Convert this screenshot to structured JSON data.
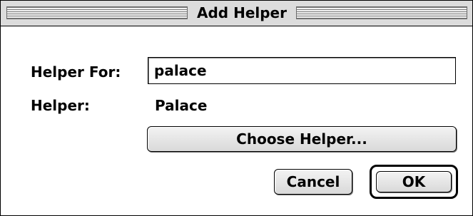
{
  "window": {
    "title": "Add Helper"
  },
  "form": {
    "helper_for_label": "Helper For:",
    "helper_for_value": "palace",
    "helper_label": "Helper:",
    "helper_value": "Palace"
  },
  "buttons": {
    "choose_helper": "Choose Helper...",
    "cancel": "Cancel",
    "ok": "OK"
  }
}
